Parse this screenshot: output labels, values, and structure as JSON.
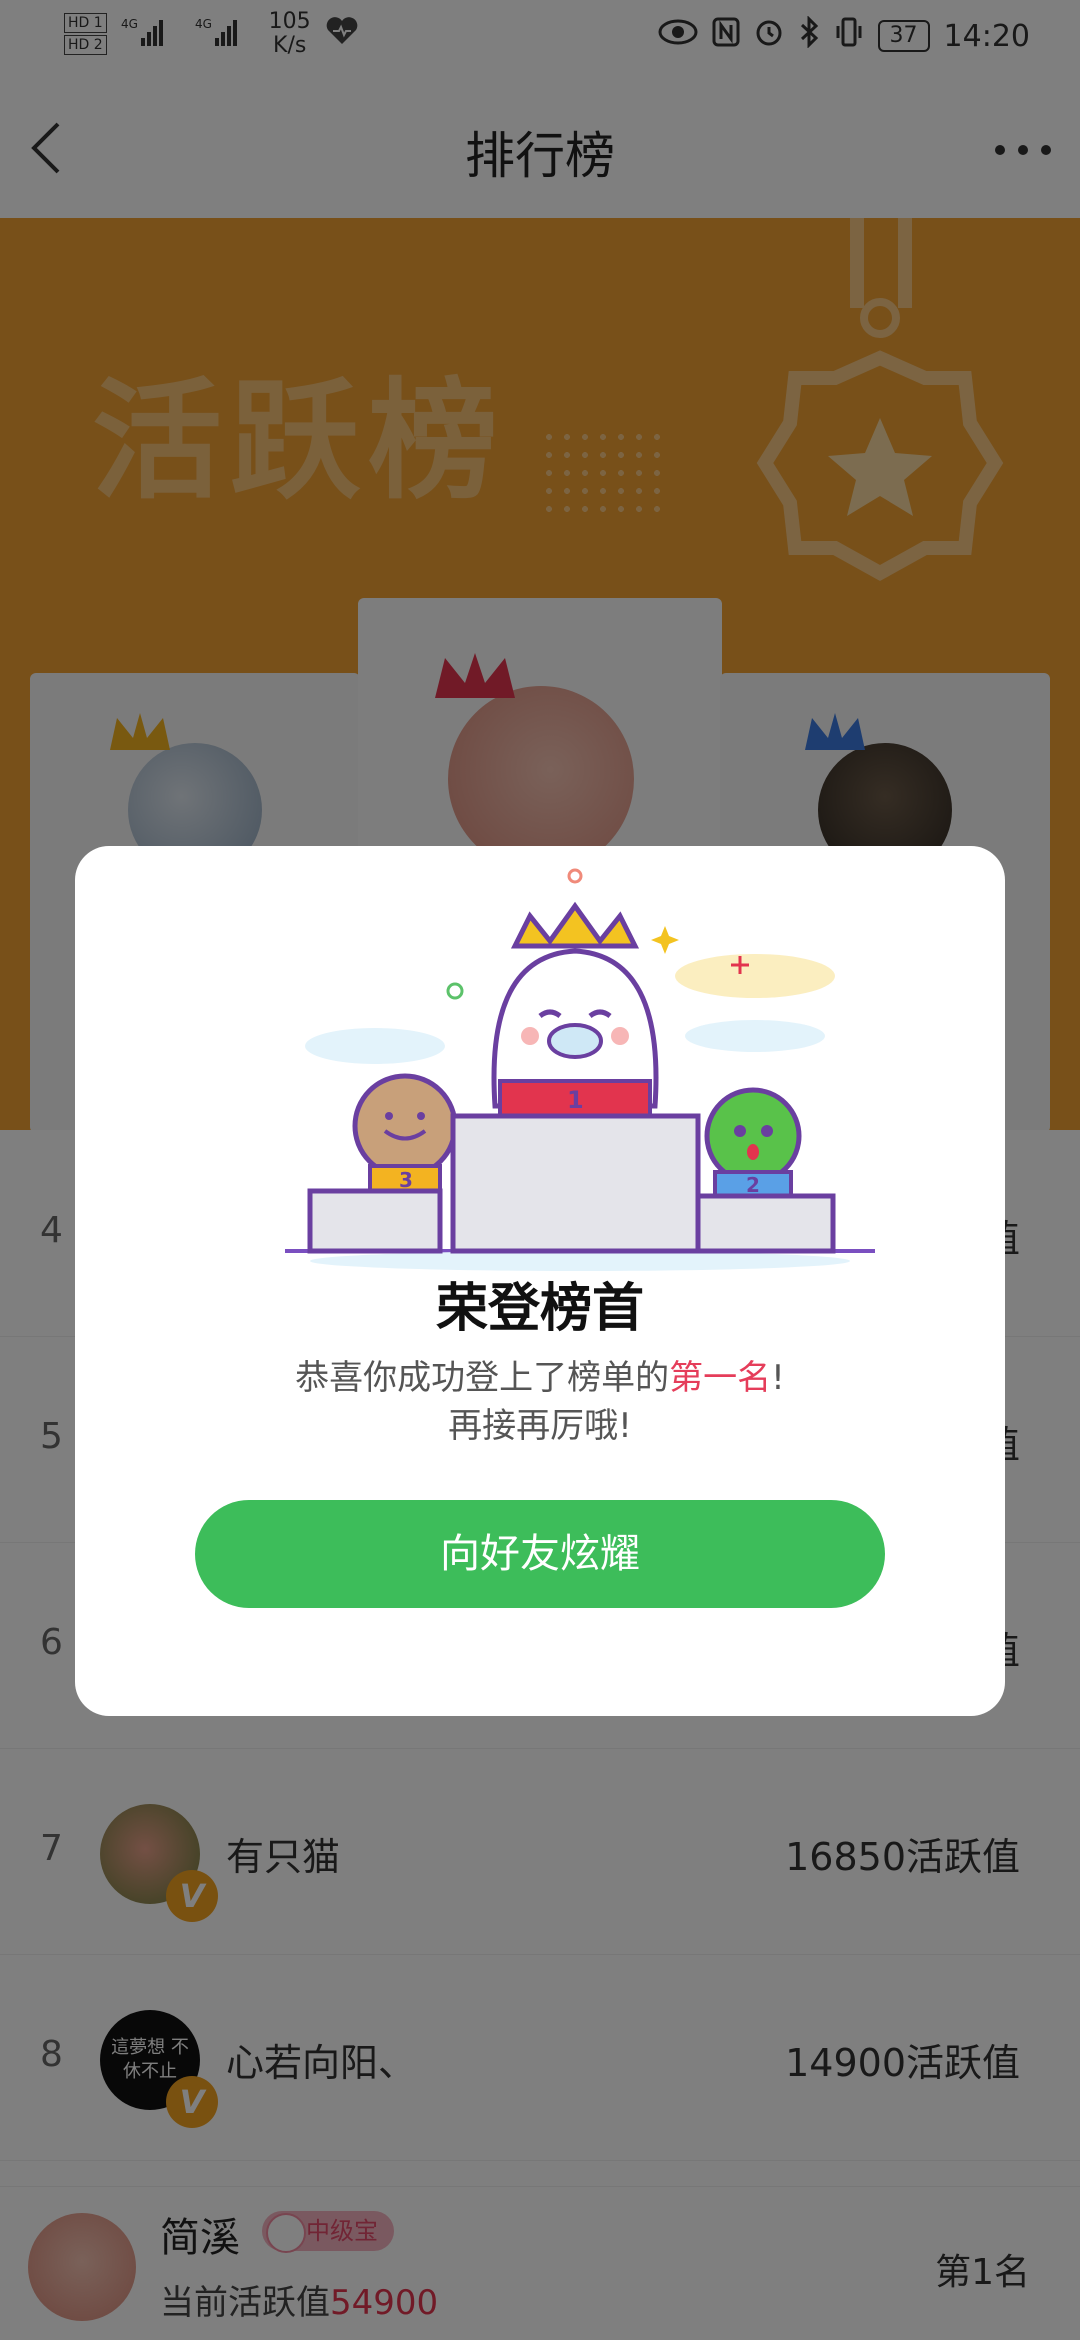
{
  "status_bar": {
    "sim1": "HD 1",
    "sim2": "HD 2",
    "network": "4G",
    "speed_value": "105",
    "speed_unit": "K/s",
    "battery": "37",
    "time": "14:20"
  },
  "nav": {
    "title": "排行榜"
  },
  "banner": {
    "title": "活跃榜"
  },
  "list": [
    {
      "rank": "4",
      "score": "值"
    },
    {
      "rank": "5",
      "score": "值"
    },
    {
      "rank": "6",
      "score": "值"
    },
    {
      "rank": "7",
      "name": "有只猫",
      "score": "16850活跃值",
      "badge": "V"
    },
    {
      "rank": "8",
      "name": "心若向阳、",
      "score": "14900活跃值",
      "badge": "V",
      "avatar_text": "這夢想 不休不止"
    }
  ],
  "bottom_bar": {
    "name": "简溪",
    "level": "中级宝",
    "score_label": "当前活跃值",
    "score": "54900",
    "rank": "第1名"
  },
  "modal": {
    "illustration_labels": {
      "first": "1",
      "second": "2",
      "third": "3"
    },
    "title": "荣登榜首",
    "message_before": "恭喜你成功登上了榜单的",
    "message_highlight": "第一名",
    "message_after": "!",
    "message_line2": "再接再厉哦!",
    "button_label": "向好友炫耀"
  },
  "colors": {
    "banner": "#f0a033",
    "primary_button": "#3dbd5a",
    "highlight": "#e53d5a"
  }
}
